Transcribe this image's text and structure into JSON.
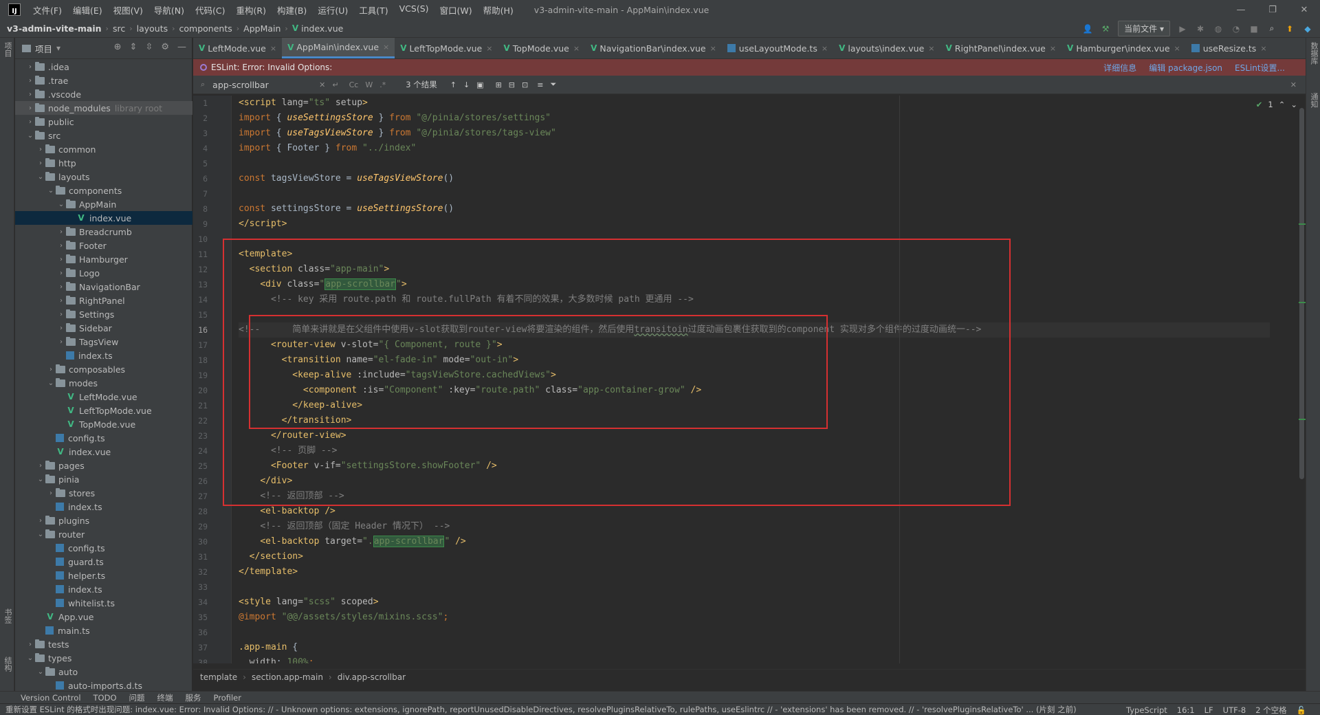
{
  "menubar": {
    "logo": "IJ",
    "items": [
      "文件(F)",
      "编辑(E)",
      "视图(V)",
      "导航(N)",
      "代码(C)",
      "重构(R)",
      "构建(B)",
      "运行(U)",
      "工具(T)",
      "VCS(S)",
      "窗口(W)",
      "帮助(H)"
    ],
    "window_title": "v3-admin-vite-main - AppMain\\index.vue"
  },
  "navbar": {
    "crumbs": [
      "v3-admin-vite-main",
      "src",
      "layouts",
      "components",
      "AppMain",
      "index.vue"
    ],
    "run_config": "当前文件"
  },
  "left_stripe": {
    "project_label": "项目",
    "bookmarks_label": "书签",
    "structure_label": "结构"
  },
  "right_stripe": {
    "db_label": "数据库",
    "notify_label": "通知"
  },
  "project_panel": {
    "title": "项目",
    "tree": [
      {
        "indent": 1,
        "arrow": "›",
        "type": "folder",
        "label": ".idea"
      },
      {
        "indent": 1,
        "arrow": "›",
        "type": "folder",
        "label": ".trae"
      },
      {
        "indent": 1,
        "arrow": "›",
        "type": "folder",
        "label": ".vscode"
      },
      {
        "indent": 1,
        "arrow": "›",
        "type": "folder",
        "label": "node_modules",
        "extra": "library root",
        "hover": true
      },
      {
        "indent": 1,
        "arrow": "›",
        "type": "folder",
        "label": "public"
      },
      {
        "indent": 1,
        "arrow": "⌄",
        "type": "folder",
        "label": "src"
      },
      {
        "indent": 2,
        "arrow": "›",
        "type": "folder",
        "label": "common"
      },
      {
        "indent": 2,
        "arrow": "›",
        "type": "folder",
        "label": "http"
      },
      {
        "indent": 2,
        "arrow": "⌄",
        "type": "folder",
        "label": "layouts"
      },
      {
        "indent": 3,
        "arrow": "⌄",
        "type": "folder",
        "label": "components"
      },
      {
        "indent": 4,
        "arrow": "⌄",
        "type": "folder",
        "label": "AppMain"
      },
      {
        "indent": 5,
        "arrow": "",
        "type": "vue",
        "label": "index.vue",
        "selected": true
      },
      {
        "indent": 4,
        "arrow": "›",
        "type": "folder",
        "label": "Breadcrumb"
      },
      {
        "indent": 4,
        "arrow": "›",
        "type": "folder",
        "label": "Footer"
      },
      {
        "indent": 4,
        "arrow": "›",
        "type": "folder",
        "label": "Hamburger"
      },
      {
        "indent": 4,
        "arrow": "›",
        "type": "folder",
        "label": "Logo"
      },
      {
        "indent": 4,
        "arrow": "›",
        "type": "folder",
        "label": "NavigationBar"
      },
      {
        "indent": 4,
        "arrow": "›",
        "type": "folder",
        "label": "RightPanel"
      },
      {
        "indent": 4,
        "arrow": "›",
        "type": "folder",
        "label": "Settings"
      },
      {
        "indent": 4,
        "arrow": "›",
        "type": "folder",
        "label": "Sidebar"
      },
      {
        "indent": 4,
        "arrow": "›",
        "type": "folder",
        "label": "TagsView"
      },
      {
        "indent": 4,
        "arrow": "",
        "type": "ts",
        "label": "index.ts"
      },
      {
        "indent": 3,
        "arrow": "›",
        "type": "folder",
        "label": "composables"
      },
      {
        "indent": 3,
        "arrow": "⌄",
        "type": "folder",
        "label": "modes"
      },
      {
        "indent": 4,
        "arrow": "",
        "type": "vue",
        "label": "LeftMode.vue"
      },
      {
        "indent": 4,
        "arrow": "",
        "type": "vue",
        "label": "LeftTopMode.vue"
      },
      {
        "indent": 4,
        "arrow": "",
        "type": "vue",
        "label": "TopMode.vue"
      },
      {
        "indent": 3,
        "arrow": "",
        "type": "ts",
        "label": "config.ts"
      },
      {
        "indent": 3,
        "arrow": "",
        "type": "vue",
        "label": "index.vue"
      },
      {
        "indent": 2,
        "arrow": "›",
        "type": "folder",
        "label": "pages"
      },
      {
        "indent": 2,
        "arrow": "⌄",
        "type": "folder",
        "label": "pinia"
      },
      {
        "indent": 3,
        "arrow": "›",
        "type": "folder",
        "label": "stores"
      },
      {
        "indent": 3,
        "arrow": "",
        "type": "ts",
        "label": "index.ts"
      },
      {
        "indent": 2,
        "arrow": "›",
        "type": "folder",
        "label": "plugins"
      },
      {
        "indent": 2,
        "arrow": "⌄",
        "type": "folder",
        "label": "router"
      },
      {
        "indent": 3,
        "arrow": "",
        "type": "ts",
        "label": "config.ts"
      },
      {
        "indent": 3,
        "arrow": "",
        "type": "ts",
        "label": "guard.ts"
      },
      {
        "indent": 3,
        "arrow": "",
        "type": "ts",
        "label": "helper.ts"
      },
      {
        "indent": 3,
        "arrow": "",
        "type": "ts",
        "label": "index.ts"
      },
      {
        "indent": 3,
        "arrow": "",
        "type": "ts",
        "label": "whitelist.ts"
      },
      {
        "indent": 2,
        "arrow": "",
        "type": "vue",
        "label": "App.vue"
      },
      {
        "indent": 2,
        "arrow": "",
        "type": "ts",
        "label": "main.ts"
      },
      {
        "indent": 1,
        "arrow": "›",
        "type": "folder",
        "label": "tests"
      },
      {
        "indent": 1,
        "arrow": "⌄",
        "type": "folder",
        "label": "types"
      },
      {
        "indent": 2,
        "arrow": "⌄",
        "type": "folder",
        "label": "auto"
      },
      {
        "indent": 3,
        "arrow": "",
        "type": "ts",
        "label": "auto-imports.d.ts"
      }
    ]
  },
  "tabs": [
    {
      "label": "LeftMode.vue",
      "type": "vue"
    },
    {
      "label": "AppMain\\index.vue",
      "type": "vue",
      "active": true
    },
    {
      "label": "LeftTopMode.vue",
      "type": "vue"
    },
    {
      "label": "TopMode.vue",
      "type": "vue"
    },
    {
      "label": "NavigationBar\\index.vue",
      "type": "vue"
    },
    {
      "label": "useLayoutMode.ts",
      "type": "ts"
    },
    {
      "label": "layouts\\index.vue",
      "type": "vue"
    },
    {
      "label": "RightPanel\\index.vue",
      "type": "vue"
    },
    {
      "label": "Hamburger\\index.vue",
      "type": "vue"
    },
    {
      "label": "useResize.ts",
      "type": "ts"
    }
  ],
  "eslint_bar": {
    "message": "ESLint: Error: Invalid Options:",
    "actions": [
      "详细信息",
      "编辑 package.json",
      "ESLint设置..."
    ]
  },
  "search": {
    "value": "app-scrollbar",
    "placeholder": "",
    "result_count": "3 个结果",
    "match_case": "Cc",
    "words": "W",
    "regex": ".*"
  },
  "inspections": {
    "count": "1"
  },
  "code": {
    "current_line": 16,
    "lines": [
      "<span class=\"tag\">&lt;script</span> <span class=\"attr\">lang=</span><span class=\"str\">\"ts\"</span> <span class=\"attr\">setup</span><span class=\"tag\">&gt;</span>",
      "<span class=\"kw\">import</span> { <span class=\"fn\">useSettingsStore</span> } <span class=\"kw\">from</span> <span class=\"str\">\"@/pinia/stores/settings\"</span>",
      "<span class=\"kw\">import</span> { <span class=\"fn\">useTagsViewStore</span> } <span class=\"kw\">from</span> <span class=\"str\">\"@/pinia/stores/tags-view\"</span>",
      "<span class=\"kw\">import</span> { Footer } <span class=\"kw\">from</span> <span class=\"str\">\"../index\"</span>",
      "",
      "<span class=\"kw\">const</span> tagsViewStore = <span class=\"fn\">useTagsViewStore</span>()",
      "",
      "<span class=\"kw\">const</span> settingsStore = <span class=\"fn\">useSettingsStore</span>()",
      "<span class=\"tag\">&lt;/script&gt;</span>",
      "",
      "<span class=\"tag\">&lt;template&gt;</span>",
      "  <span class=\"tag\">&lt;section</span> <span class=\"attr\">class=</span><span class=\"str\">\"app-main\"</span><span class=\"tag\">&gt;</span>",
      "    <span class=\"tag\">&lt;div</span> <span class=\"attr\">class=</span><span class=\"str\">\"<span class=\"hl\">app-scrollbar</span>\"</span><span class=\"tag\">&gt;</span>",
      "      <span class=\"cmt\">&lt;!-- key 采用 route.path 和 route.fullPath 有着不同的效果，大多数时候 path 更通用 --&gt;</span>",
      "",
      "<span class=\"cmt\">&lt;!--      简单来讲就是在父组件中使用v-slot获取到router-view将要渲染的组件，然后使用<span class=\"squig\">transitoin</span>过度动画包裹住获取到的component 实现对多个组件的过度动画统一--&gt;</span>",
      "      <span class=\"tag\">&lt;router-view</span> <span class=\"attr\">v-slot=</span><span class=\"str\">\"{ Component, route }\"</span><span class=\"tag\">&gt;</span>",
      "        <span class=\"tag\">&lt;transition</span> <span class=\"attr\">name=</span><span class=\"str\">\"el-fade-in\"</span> <span class=\"attr\">mode=</span><span class=\"str\">\"out-in\"</span><span class=\"tag\">&gt;</span>",
      "          <span class=\"tag\">&lt;keep-alive</span> <span class=\"attr\">:include=</span><span class=\"str\">\"tagsViewStore.cachedViews\"</span><span class=\"tag\">&gt;</span>",
      "            <span class=\"tag\">&lt;component</span> <span class=\"attr\">:is=</span><span class=\"str\">\"Component\"</span> <span class=\"attr\">:key=</span><span class=\"str\">\"route.path\"</span> <span class=\"attr\">class=</span><span class=\"str\">\"app-container-grow\"</span> <span class=\"tag\">/&gt;</span>",
      "          <span class=\"tag\">&lt;/keep-alive&gt;</span>",
      "        <span class=\"tag\">&lt;/transition&gt;</span>",
      "      <span class=\"tag\">&lt;/router-view&gt;</span>",
      "      <span class=\"cmt\">&lt;!-- 页脚 --&gt;</span>",
      "      <span class=\"tag\">&lt;Footer</span> <span class=\"attr\">v-if=</span><span class=\"str\">\"settingsStore.showFooter\"</span> <span class=\"tag\">/&gt;</span>",
      "    <span class=\"tag\">&lt;/div&gt;</span>",
      "    <span class=\"cmt\">&lt;!-- 返回顶部 --&gt;</span>",
      "    <span class=\"tag\">&lt;el-backtop /&gt;</span>",
      "    <span class=\"cmt\">&lt;!-- 返回顶部（固定 Header 情况下） --&gt;</span>",
      "    <span class=\"tag\">&lt;el-backtop</span> <span class=\"attr\">target=</span><span class=\"str\">\".<span class=\"hl\">app-scrollbar</span>\"</span> <span class=\"tag\">/&gt;</span>",
      "  <span class=\"tag\">&lt;/section&gt;</span>",
      "<span class=\"tag\">&lt;/template&gt;</span>",
      "",
      "<span class=\"tag\">&lt;style</span> <span class=\"attr\">lang=</span><span class=\"str\">\"scss\"</span> <span class=\"attr\">scoped</span><span class=\"tag\">&gt;</span>",
      "<span class=\"kw\">@import</span> <span class=\"str\">\"@@/assets/styles/mixins.scss\"</span><span class=\"kw\">;</span>",
      "",
      "<span class=\"tag\">.app-main</span> {",
      "  <span class=\"attr\">width</span>: <span class=\"str\">100%</span><span class=\"kw\">;</span>"
    ]
  },
  "editor_breadcrumb": [
    "template",
    "section.app-main",
    "div.app-scrollbar"
  ],
  "tool_windows": [
    "Version Control",
    "TODO",
    "问题",
    "终端",
    "服务",
    "Profiler"
  ],
  "status": {
    "message": "重新设置 ESLint 的格式时出现问题: index.vue: Error: Invalid Options: // - Unknown options: extensions, ignorePath, reportUnusedDisableDirectives, resolvePluginsRelativeTo, rulePaths, useEslintrc // - 'extensions' has been removed. // - 'resolvePluginsRelativeTo' ... (片刻 之前)",
    "language": "TypeScript",
    "position": "16:1",
    "line_sep": "LF",
    "encoding": "UTF-8",
    "indent": "2 个空格"
  }
}
